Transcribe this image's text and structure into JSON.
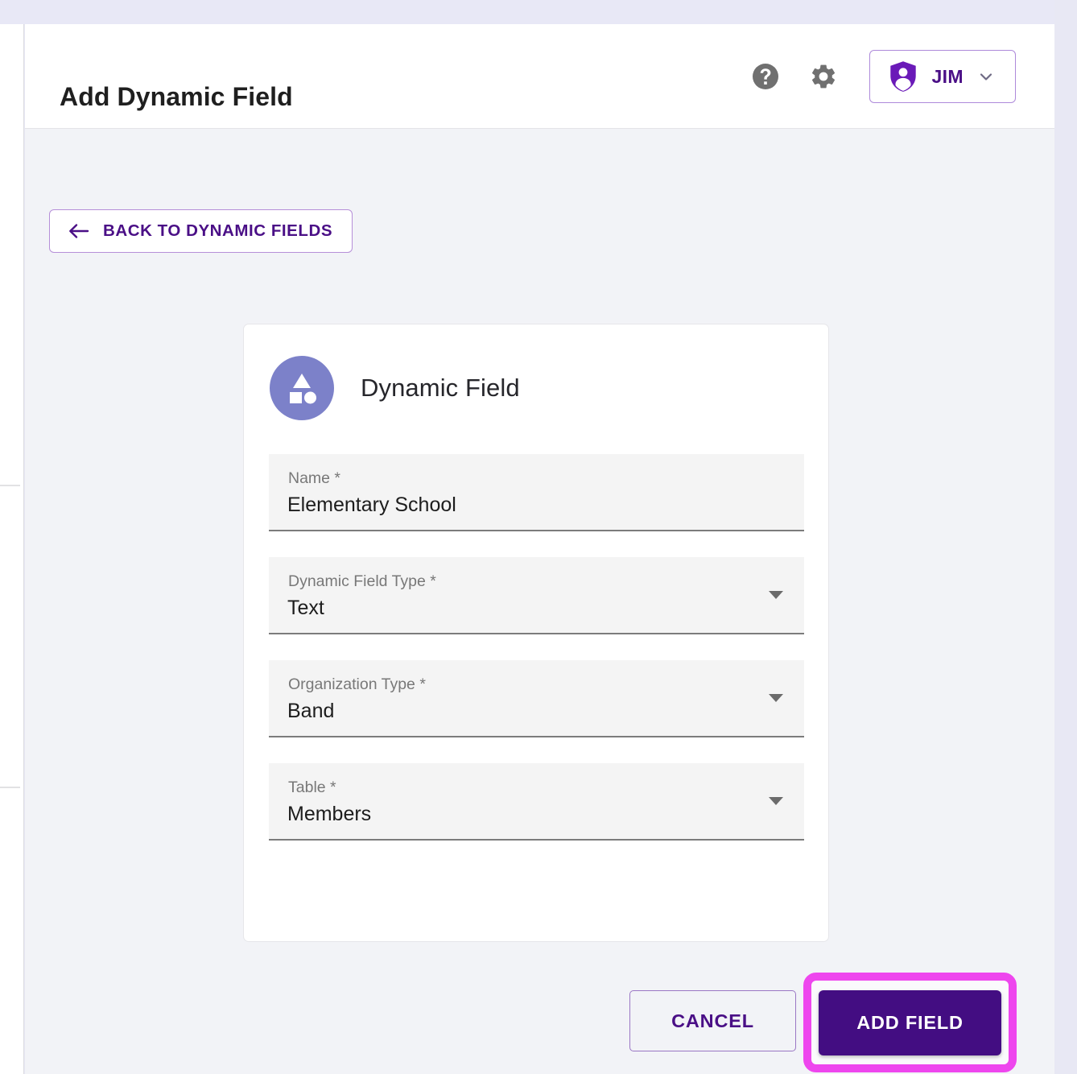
{
  "header": {
    "title": "Add Dynamic Field",
    "help_icon": "help-circle-icon",
    "settings_icon": "gear-icon",
    "user_name": "JIM",
    "user_icon": "shield-person-icon",
    "user_chevron_icon": "chevron-down-icon"
  },
  "toolbar": {
    "back_label": "BACK TO DYNAMIC FIELDS",
    "back_icon": "arrow-left-icon"
  },
  "card": {
    "title": "Dynamic Field",
    "avatar_icon": "shapes-icon",
    "fields": [
      {
        "label": "Name *",
        "value": "Elementary School",
        "type": "text"
      },
      {
        "label": "Dynamic Field Type *",
        "value": "Text",
        "type": "select",
        "caret_icon": "caret-down-icon"
      },
      {
        "label": "Organization Type *",
        "value": "Band",
        "type": "select",
        "caret_icon": "caret-down-icon"
      },
      {
        "label": "Table *",
        "value": "Members",
        "type": "select",
        "caret_icon": "caret-down-icon"
      }
    ]
  },
  "actions": {
    "cancel_label": "CANCEL",
    "add_label": "ADD FIELD"
  },
  "colors": {
    "brand_purple": "#4a0f86",
    "button_purple": "#430d82",
    "highlight_magenta": "#ee46ee",
    "avatar_periwinkle": "#7c81c9",
    "page_background": "#f2f3f7",
    "field_background": "#f4f4f4"
  }
}
